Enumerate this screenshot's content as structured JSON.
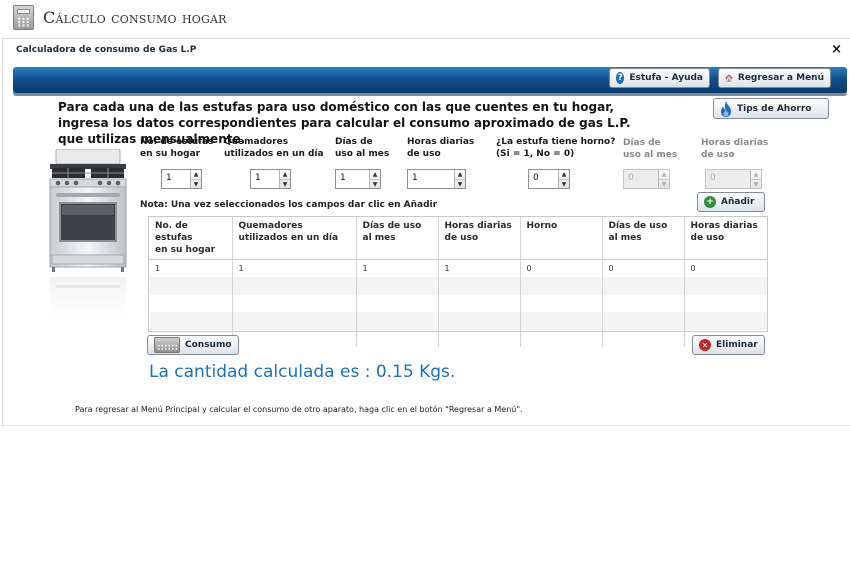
{
  "app": {
    "title": "Cálculo consumo hogar"
  },
  "window": {
    "title": "Calculadora de consumo de Gas L.P",
    "close_label": "×"
  },
  "toolbar": {
    "help_label": "Estufa - Ayuda",
    "back_label": "Regresar a Menú"
  },
  "tips_label": "Tips de Ahorro",
  "intro": "Para cada una de las estufas para uso doméstico con las que cuentes en tu hogar, ingresa los datos correspondientes para calcular el consumo aproximado de gas L.P. que utilizas mensualmente.",
  "fields": [
    {
      "label": "No. de estufas\nen su hogar",
      "value": "1",
      "disabled": false
    },
    {
      "label": "Quemadores\nutilizados en un día",
      "value": "1",
      "disabled": false
    },
    {
      "label": "Días de\nuso al mes",
      "value": "1",
      "disabled": false
    },
    {
      "label": "Horas diarias\nde uso",
      "value": "1",
      "disabled": false
    },
    {
      "label": "¿La estufa tiene horno?\n(Si = 1, No = 0)",
      "value": "0",
      "disabled": false
    },
    {
      "label": "Días de\nuso al mes",
      "value": "0",
      "disabled": true
    },
    {
      "label": "Horas diarias\nde uso",
      "value": "0",
      "disabled": true
    }
  ],
  "note": "Nota: Una vez seleccionados los campos dar clic en Añadir",
  "add_label": "Añadir",
  "table": {
    "headers": [
      "No. de estufas\nen su hogar",
      "Quemadores\nutilizados en un día",
      "Días de uso\nal mes",
      "Horas diarias\nde uso",
      "Horno",
      "Días de uso\nal mes",
      "Horas diarias\nde uso"
    ],
    "rows": [
      [
        "1",
        "1",
        "1",
        "1",
        "0",
        "0",
        "0"
      ]
    ]
  },
  "calc_label": "Consumo",
  "delete_label": "Eliminar",
  "result": "La cantidad calculada es : 0.15 Kgs.",
  "footer": "Para regresar al Menú Principal y calcular el consumo de otro aparato, haga clic en el botón \"Regresar a Menú\"."
}
